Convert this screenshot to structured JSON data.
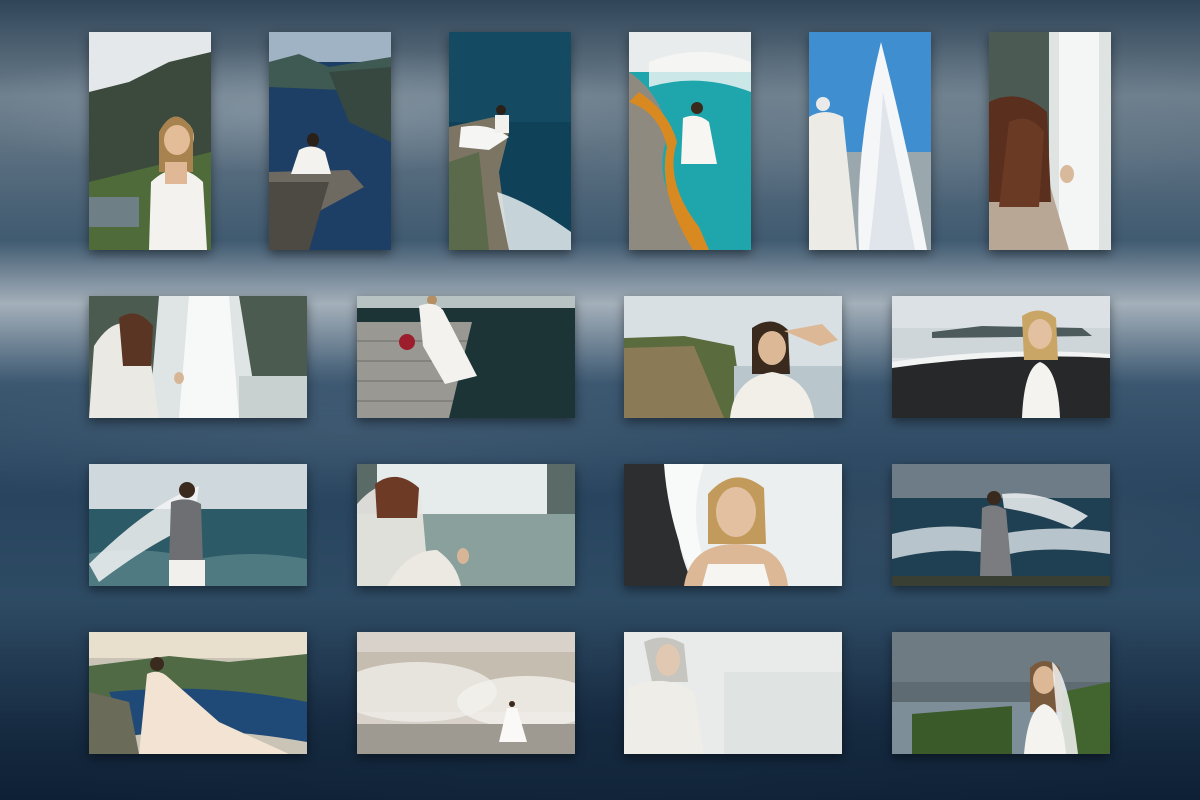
{
  "gallery": {
    "rows": 4,
    "photos": [
      {
        "id": "p1",
        "scene": "cliff-laughing-portrait"
      },
      {
        "id": "p2",
        "scene": "fjord-rock-ledge"
      },
      {
        "id": "p3",
        "scene": "sea-cliff-aerial"
      },
      {
        "id": "p4",
        "scene": "hot-spring-pool"
      },
      {
        "id": "p5",
        "scene": "geyser-eruption"
      },
      {
        "id": "p6",
        "scene": "waterfall-curly-hair"
      },
      {
        "id": "p7",
        "scene": "waterfall-veil"
      },
      {
        "id": "p8",
        "scene": "lake-dock-bouquet"
      },
      {
        "id": "p9",
        "scene": "cliff-shading-eyes"
      },
      {
        "id": "p10",
        "scene": "black-sand-beach"
      },
      {
        "id": "p11",
        "scene": "ocean-veil-sweater"
      },
      {
        "id": "p12",
        "scene": "waterfall-veil-back"
      },
      {
        "id": "p13",
        "scene": "beach-closeup-laugh"
      },
      {
        "id": "p14",
        "scene": "stormy-sea-veil"
      },
      {
        "id": "p15",
        "scene": "fjord-flowing-gown"
      },
      {
        "id": "p16",
        "scene": "steam-field"
      },
      {
        "id": "p17",
        "scene": "misty-portrait"
      },
      {
        "id": "p18",
        "scene": "green-cliff-laugh"
      }
    ]
  }
}
